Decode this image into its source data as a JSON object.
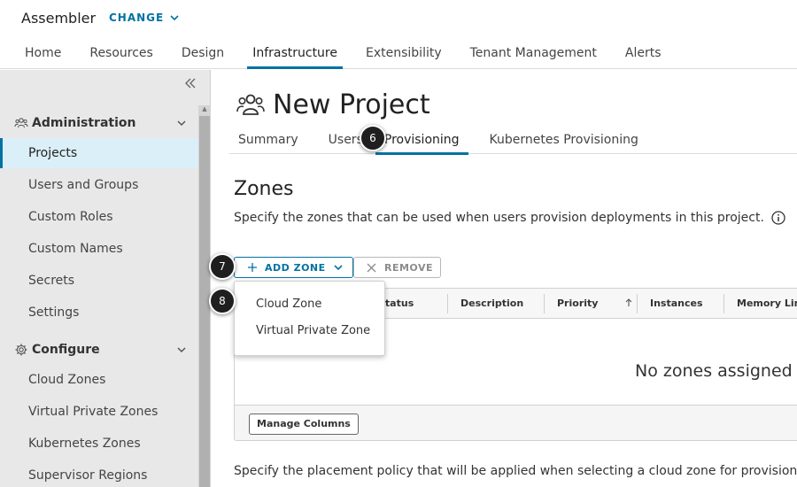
{
  "header": {
    "app_title": "Assembler",
    "change_label": "CHANGE",
    "nav": [
      {
        "label": "Home"
      },
      {
        "label": "Resources"
      },
      {
        "label": "Design"
      },
      {
        "label": "Infrastructure",
        "active": true
      },
      {
        "label": "Extensibility"
      },
      {
        "label": "Tenant Management"
      },
      {
        "label": "Alerts"
      }
    ]
  },
  "sidebar": {
    "collapse_icon": "double-chevron-left-icon",
    "sections": [
      {
        "title": "Administration",
        "icon": "users-group-icon",
        "items": [
          {
            "label": "Projects",
            "active": true
          },
          {
            "label": "Users and Groups"
          },
          {
            "label": "Custom Roles"
          },
          {
            "label": "Custom Names"
          },
          {
            "label": "Secrets"
          },
          {
            "label": "Settings"
          }
        ]
      },
      {
        "title": "Configure",
        "icon": "gear-icon",
        "items": [
          {
            "label": "Cloud Zones"
          },
          {
            "label": "Virtual Private Zones"
          },
          {
            "label": "Kubernetes Zones"
          },
          {
            "label": "Supervisor Regions"
          }
        ]
      }
    ]
  },
  "page": {
    "title": "New Project",
    "title_icon": "users-group-icon",
    "tabs": [
      {
        "label": "Summary"
      },
      {
        "label": "Users"
      },
      {
        "label": "Provisioning",
        "active": true
      },
      {
        "label": "Kubernetes Provisioning"
      }
    ]
  },
  "zones": {
    "title": "Zones",
    "description": "Specify the zones that can be used when users provision deployments in this project.",
    "add_zone_label": "ADD ZONE",
    "remove_label": "REMOVE",
    "columns": [
      {
        "label": "Status"
      },
      {
        "label": "Description"
      },
      {
        "label": "Priority"
      },
      {
        "label": "Instances"
      },
      {
        "label": "Memory Limit"
      }
    ],
    "empty_message": "No zones assigned",
    "manage_columns_label": "Manage Columns",
    "dropdown": [
      {
        "label": "Cloud Zone"
      },
      {
        "label": "Virtual Private Zone"
      }
    ]
  },
  "placement": {
    "description": "Specify the placement policy that will be applied when selecting a cloud zone for provisioning."
  },
  "steps": {
    "tab_step": "6",
    "add_step": "7",
    "menu_step": "8"
  },
  "colors": {
    "accent": "#0072a3",
    "sidebar_bg": "#e8e8e8",
    "active_item_bg": "#dbeff8",
    "badge_bg": "#1f1f1f"
  }
}
